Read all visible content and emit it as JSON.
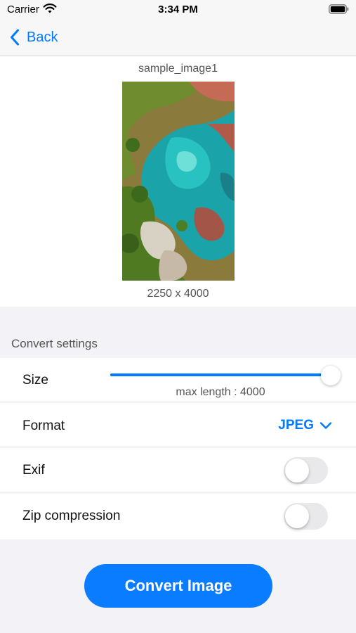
{
  "status_bar": {
    "carrier": "Carrier",
    "time": "3:34 PM",
    "icons": [
      "wifi-icon",
      "battery-icon"
    ]
  },
  "nav": {
    "back_label": "Back",
    "back_icon": "chevron-left-icon"
  },
  "preview": {
    "image_name": "sample_image1",
    "dimensions": "2250 x 4000"
  },
  "settings": {
    "header": "Convert settings",
    "size": {
      "label": "Size",
      "slider_fraction": 1.0,
      "caption": "max length : 4000"
    },
    "format": {
      "label": "Format",
      "value": "JPEG",
      "icon": "chevron-down-icon"
    },
    "exif": {
      "label": "Exif",
      "enabled": false
    },
    "zip": {
      "label": "Zip compression",
      "enabled": false
    }
  },
  "actions": {
    "convert_label": "Convert Image"
  },
  "colors": {
    "accent": "#007aff",
    "button": "#0a7cff",
    "background": "#f2f2f7"
  }
}
